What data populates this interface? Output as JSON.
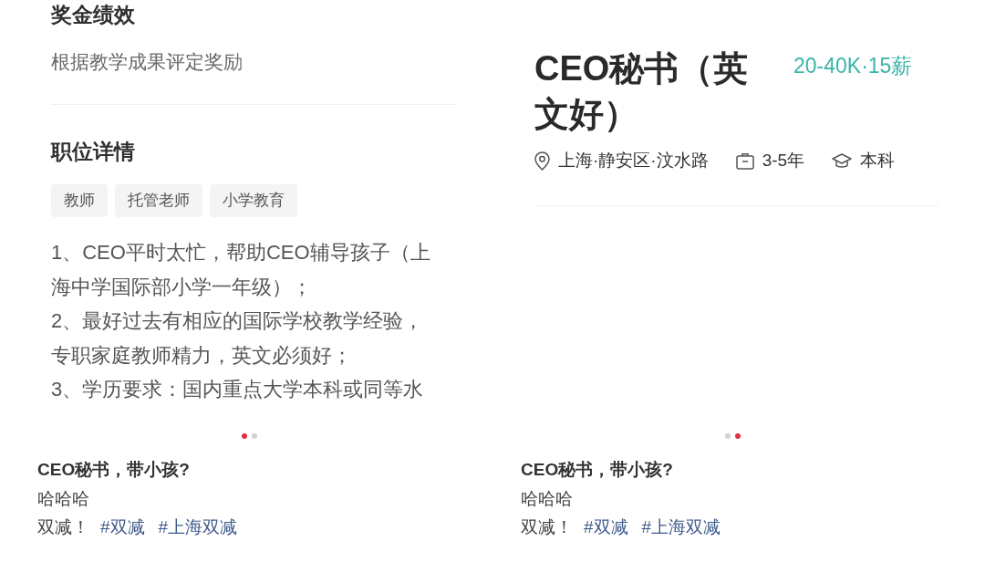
{
  "posts": [
    {
      "slide": {
        "kind": "job_details",
        "sections": [
          {
            "heading": "奖金绩效",
            "text": "根据教学成果评定奖励"
          },
          {
            "heading": "职位详情",
            "tags": [
              "教师",
              "托管老师",
              "小学教育"
            ],
            "items": [
              "1、CEO平时太忙，帮助CEO辅导孩子（上海中学国际部小学一年级）；",
              "2、最好过去有相应的国际学校教学经验，专职家庭教师精力，英文必须好；",
              "3、学历要求：国内重点大学本科或同等水"
            ]
          }
        ]
      },
      "pagination": [
        {
          "selected": true
        },
        {
          "selected": false
        }
      ],
      "caption": {
        "title": "CEO秘书，带小孩?",
        "body": "哈哈哈",
        "text": "双减！",
        "hashtags": [
          "#双减",
          "#上海双减"
        ]
      }
    },
    {
      "slide": {
        "kind": "job_header",
        "title": "CEO秘书（英文好）",
        "salary": "20-40K·15薪",
        "meta": [
          {
            "kind": "location",
            "text": "上海·静安区·汶水路"
          },
          {
            "kind": "experience",
            "text": "3-5年"
          },
          {
            "kind": "education",
            "text": "本科"
          }
        ]
      },
      "pagination": [
        {
          "selected": false
        },
        {
          "selected": true
        }
      ],
      "caption": {
        "title": "CEO秘书，带小孩?",
        "body": "哈哈哈",
        "text": "双减！",
        "hashtags": [
          "#双减",
          "#上海双减"
        ]
      }
    }
  ]
}
